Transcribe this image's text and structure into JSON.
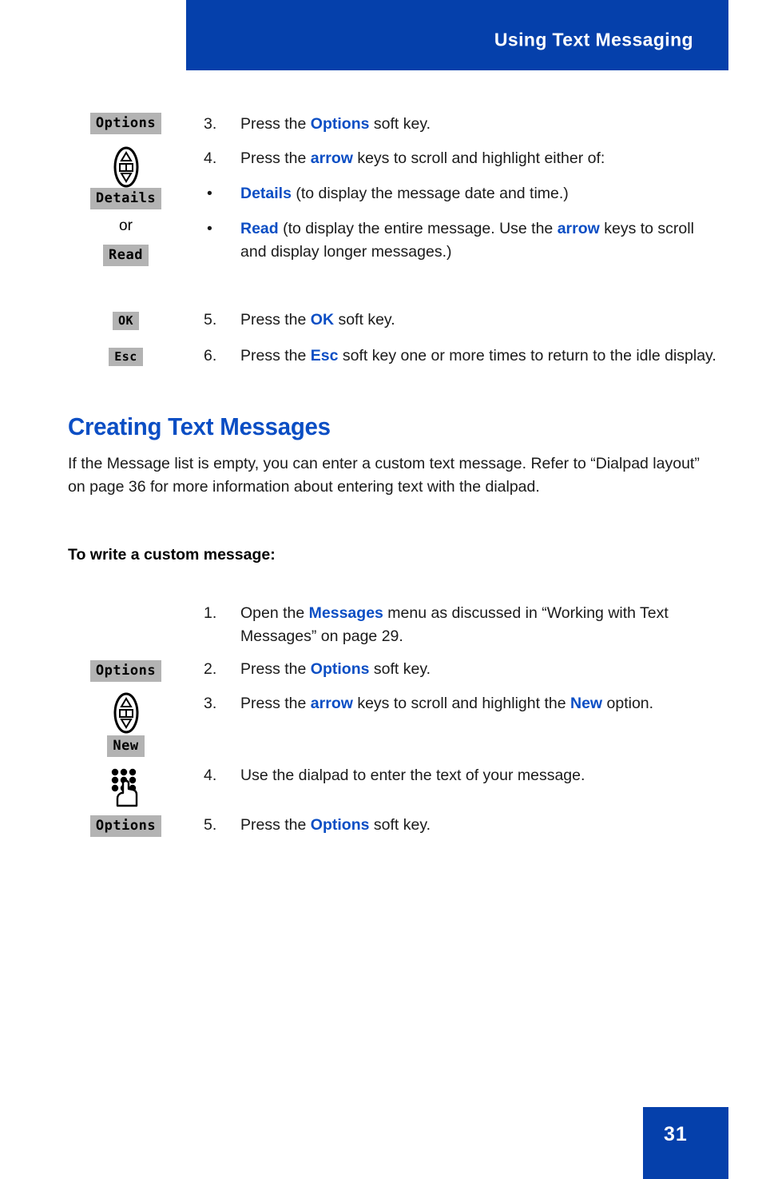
{
  "header": {
    "title": "Using Text Messaging",
    "banner_color": "#0540ab"
  },
  "footer": {
    "page_number": "31",
    "box_color": "#0540ab"
  },
  "colors": {
    "accent_blue": "#0b4ec4",
    "banner_blue": "#0540ab",
    "softkey_gray": "#b3b3b3"
  },
  "section_one": {
    "gutter": {
      "softkey_options": "Options",
      "nav_icon": "arrow-keys-icon",
      "softkey_details": "Details",
      "or_label": "or",
      "softkey_read": "Read",
      "softkey_ok": "OK",
      "softkey_esc": "Esc"
    },
    "steps": [
      {
        "number": "3.",
        "parts": [
          {
            "text": "Press the ",
            "bold": false
          },
          {
            "text": "Options",
            "bold": true
          },
          {
            "text": " soft key.",
            "bold": false
          }
        ]
      },
      {
        "number": "4.",
        "parts": [
          {
            "text": "Press the ",
            "bold": false
          },
          {
            "text": "arrow",
            "bold": true
          },
          {
            "text": " keys to scroll and highlight either of:",
            "bold": false
          }
        ]
      }
    ],
    "bullets": [
      {
        "marker": "•",
        "parts": [
          {
            "text": "Details",
            "bold": true
          },
          {
            "text": " (to display the message date and time.)",
            "bold": false
          }
        ]
      },
      {
        "marker": "•",
        "parts": [
          {
            "text": "Read",
            "bold": true
          },
          {
            "text": " (to display the entire message. Use the ",
            "bold": false
          },
          {
            "text": "arrow",
            "bold": true
          },
          {
            "text": " keys to scroll and display longer messages.)",
            "bold": false
          }
        ]
      }
    ],
    "steps_tail": [
      {
        "number": "5.",
        "parts": [
          {
            "text": "Press the ",
            "bold": false
          },
          {
            "text": "OK",
            "bold": true
          },
          {
            "text": " soft key.",
            "bold": false
          }
        ]
      },
      {
        "number": "6.",
        "parts": [
          {
            "text": "Press the ",
            "bold": false
          },
          {
            "text": "Esc",
            "bold": true
          },
          {
            "text": " soft key one or more times to return to the idle display.",
            "bold": false
          }
        ]
      }
    ]
  },
  "section_two": {
    "heading": "Creating Text Messages",
    "paragraph": "If the Message list is empty, you can enter a custom text message. Refer to “Dialpad layout” on page 36 for more information about entering text with the dialpad.",
    "subheading": "To write a custom message:",
    "gutter": {
      "softkey_options_1": "Options",
      "nav_icon": "arrow-keys-icon",
      "softkey_new": "New",
      "dialpad_icon": "dialpad-hand-icon",
      "softkey_options_2": "Options"
    },
    "steps": [
      {
        "number": "1.",
        "parts": [
          {
            "text": "Open the ",
            "bold": false
          },
          {
            "text": "Messages",
            "bold": true
          },
          {
            "text": " menu as discussed in “Working with Text Messages” on page 29.",
            "bold": false
          }
        ]
      },
      {
        "number": "2.",
        "parts": [
          {
            "text": "Press the ",
            "bold": false
          },
          {
            "text": "Options",
            "bold": true
          },
          {
            "text": " soft key.",
            "bold": false
          }
        ]
      },
      {
        "number": "3.",
        "parts": [
          {
            "text": "Press the ",
            "bold": false
          },
          {
            "text": "arrow",
            "bold": true
          },
          {
            "text": " keys to scroll and highlight the ",
            "bold": false
          },
          {
            "text": "New",
            "bold": true
          },
          {
            "text": " option.",
            "bold": false
          }
        ]
      },
      {
        "number": "4.",
        "parts": [
          {
            "text": "Use the dialpad to enter the text of your message.",
            "bold": false
          }
        ]
      },
      {
        "number": "5.",
        "parts": [
          {
            "text": "Press the ",
            "bold": false
          },
          {
            "text": "Options",
            "bold": true
          },
          {
            "text": " soft key.",
            "bold": false
          }
        ]
      }
    ]
  }
}
